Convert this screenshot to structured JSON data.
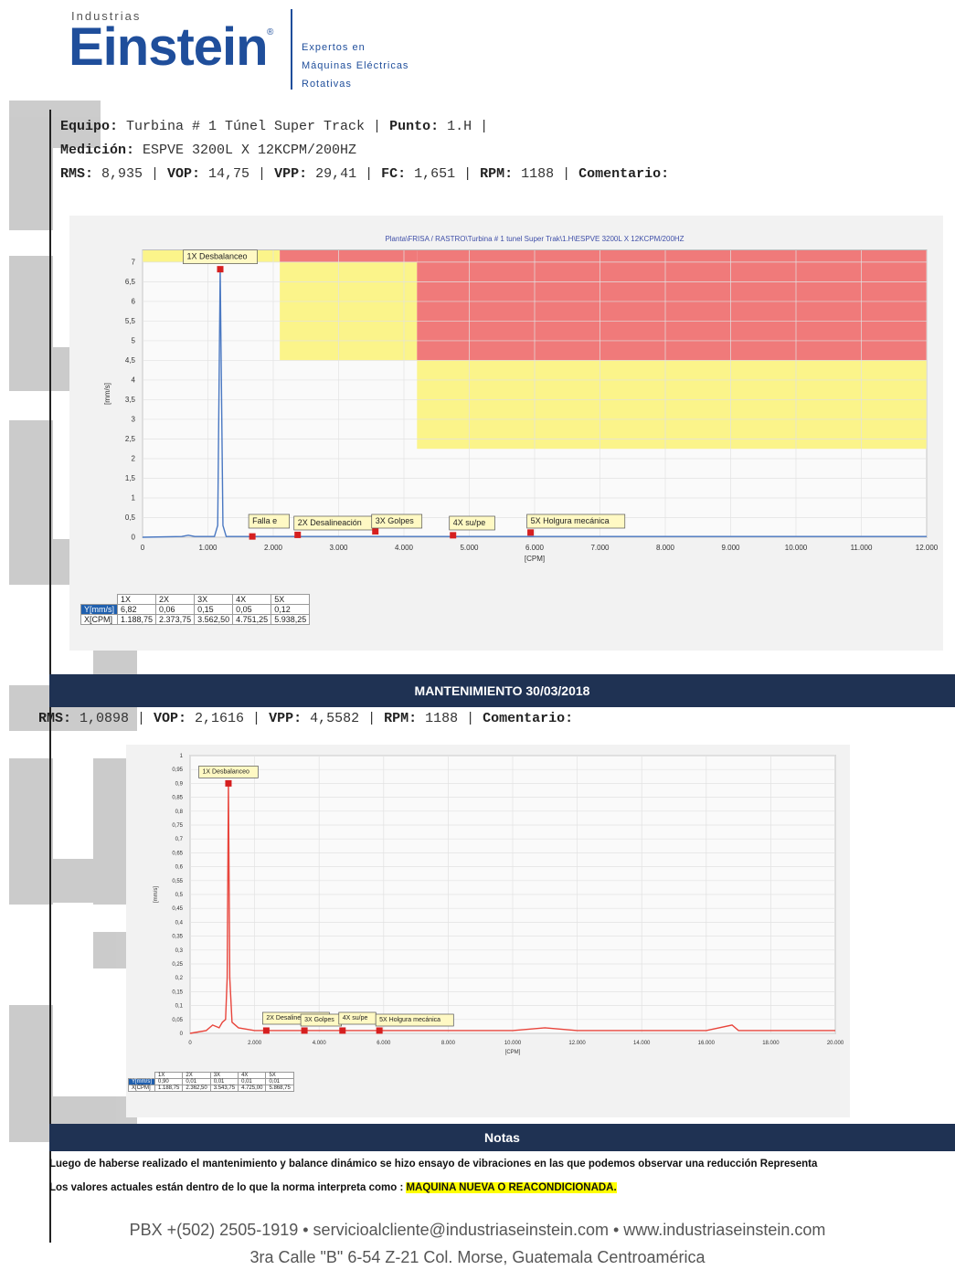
{
  "logo": {
    "small": "Industrias",
    "big": "Einstein",
    "reg": "®",
    "tag": [
      "Expertos en",
      "Máquinas Eléctricas",
      "Rotativas"
    ]
  },
  "header": {
    "line1": {
      "k1": "Equipo:",
      "v1": " Turbina # 1 Túnel Super Track | ",
      "k2": "Punto:",
      "v2": " 1.H |"
    },
    "line2": {
      "k1": "Medición:",
      "v1": " ESPVE 3200L X 12KCPM/200HZ"
    },
    "line3": {
      "k1": "RMS:",
      "v1": " 8,935 | ",
      "k2": "VOP:",
      "v2": " 14,75 | ",
      "k3": "VPP:",
      "v3": " 29,41 | ",
      "k4": "FC:",
      "v4": " 1,651 | ",
      "k5": "RPM:",
      "v5": " 1188 | ",
      "k6": "Comentario:"
    }
  },
  "chart1": {
    "title": "Planta\\FRISA / RASTRO\\Turbina # 1 tunel Super Trak\\1.H\\ESPVE 3200L X 12KCPM/200HZ",
    "table": {
      "headers": [
        "1X",
        "2X",
        "3X",
        "4X",
        "5X"
      ],
      "rows": [
        {
          "label": "Y[mm/s]",
          "values": [
            "6,82",
            "0,06",
            "0,15",
            "0,05",
            "0,12"
          ]
        },
        {
          "label": "X[CPM]",
          "values": [
            "1.188,75",
            "2.373,75",
            "3.562,50",
            "4.751,25",
            "5.938,25"
          ]
        }
      ]
    }
  },
  "chart_data": [
    {
      "type": "line",
      "title": "Planta\\FRISA / RASTRO\\Turbina # 1 tunel Super Trak\\1.H\\ESPVE 3200L X 12KCPM/200HZ",
      "xlabel": "[CPM]",
      "ylabel": "[mm/s]",
      "xlim": [
        0,
        12000
      ],
      "ylim": [
        0,
        7.3
      ],
      "x_ticks": [
        "0",
        "1.000",
        "2.000",
        "3.000",
        "4.000",
        "5.000",
        "6.000",
        "7.000",
        "8.000",
        "9.000",
        "10.000",
        "11.000",
        "12.000"
      ],
      "y_ticks": [
        "0",
        "0,5",
        "1",
        "1,5",
        "2",
        "2,5",
        "3",
        "3,5",
        "4",
        "4,5",
        "5",
        "5,5",
        "6",
        "6,5",
        "7"
      ],
      "series": [
        {
          "x": [
            0,
            600,
            700,
            800,
            1100,
            1150,
            1188,
            1230,
            1280,
            2000,
            4000,
            6000,
            8000,
            10000,
            12000
          ],
          "y": [
            0,
            0.02,
            0.05,
            0.02,
            0.02,
            0.3,
            6.82,
            0.3,
            0.02,
            0.02,
            0.02,
            0.02,
            0.02,
            0.02,
            0.02
          ]
        }
      ],
      "zones": [
        {
          "color": "#fbf48a",
          "x": [
            0,
            2100
          ],
          "y": [
            7.0,
            7.3
          ]
        },
        {
          "color": "#fbf48a",
          "x": [
            2100,
            4200
          ],
          "y": [
            4.5,
            7.0
          ]
        },
        {
          "color": "#f07a7a",
          "x": [
            2100,
            4200
          ],
          "y": [
            7.0,
            7.3
          ]
        },
        {
          "color": "#f07a7a",
          "x": [
            4200,
            12000
          ],
          "y": [
            4.5,
            7.3
          ]
        },
        {
          "color": "#fbf48a",
          "x": [
            4200,
            12000
          ],
          "y": [
            2.25,
            4.5
          ]
        }
      ],
      "markers": [
        {
          "label": "1X Desbalanceo",
          "x": 1188.75,
          "y": 6.82
        },
        {
          "label": "Falla e",
          "x": 1680,
          "y": 0.02
        },
        {
          "label": "2X Desalineación",
          "x": 2373.75,
          "y": 0.06
        },
        {
          "label": "3X Golpes",
          "x": 3562.5,
          "y": 0.15
        },
        {
          "label": "4X su/pe",
          "x": 4751.25,
          "y": 0.05
        },
        {
          "label": "5X Holgura mecánica",
          "x": 5938.25,
          "y": 0.12
        }
      ]
    },
    {
      "type": "line",
      "title": "",
      "xlabel": "[CPM]",
      "ylabel": "[mm/s]",
      "xlim": [
        0,
        20000
      ],
      "ylim": [
        0,
        1
      ],
      "x_ticks": [
        "0",
        "2.000",
        "4.000",
        "6.000",
        "8.000",
        "10.000",
        "12.000",
        "14.000",
        "16.000",
        "18.000",
        "20.000"
      ],
      "y_ticks": [
        "0",
        "0,05",
        "0,1",
        "0,15",
        "0,2",
        "0,25",
        "0,3",
        "0,35",
        "0,4",
        "0,45",
        "0,5",
        "0,55",
        "0,6",
        "0,65",
        "0,7",
        "0,75",
        "0,8",
        "0,85",
        "0,9",
        "0,95",
        "1"
      ],
      "series": [
        {
          "x": [
            0,
            500,
            700,
            900,
            1000,
            1100,
            1150,
            1188,
            1230,
            1300,
            1500,
            2000,
            3000,
            4000,
            5000,
            6000,
            7000,
            8000,
            9000,
            10000,
            11000,
            12000,
            13000,
            14000,
            15000,
            16000,
            16800,
            17000,
            18000,
            19000,
            20000
          ],
          "y": [
            0,
            0.01,
            0.03,
            0.02,
            0.04,
            0.05,
            0.2,
            0.9,
            0.2,
            0.04,
            0.02,
            0.01,
            0.01,
            0.01,
            0.01,
            0.01,
            0.01,
            0.01,
            0.01,
            0.01,
            0.02,
            0.01,
            0.01,
            0.01,
            0.01,
            0.01,
            0.03,
            0.01,
            0.01,
            0.01,
            0.01
          ]
        }
      ],
      "markers": [
        {
          "label": "1X Desbalanceo",
          "x": 1188.75,
          "y": 0.9
        },
        {
          "label": "2X Desalineación",
          "x": 2362.5,
          "y": 0.01
        },
        {
          "label": "3X Golpes",
          "x": 3543.75,
          "y": 0.01
        },
        {
          "label": "4X su/pe",
          "x": 4725,
          "y": 0.01
        },
        {
          "label": "5X Holgura mecánica",
          "x": 5868.75,
          "y": 0.01
        }
      ]
    }
  ],
  "banner1": "MANTENIMIENTO 30/03/2018",
  "line4": {
    "k1": "RMS:",
    "v1": " 1,0898 | ",
    "k2": "VOP:",
    "v2": " 2,1616 | ",
    "k3": "VPP:",
    "v3": " 4,5582 | ",
    "k4": "RPM:",
    "v4": " 1188 | ",
    "k5": "Comentario:"
  },
  "chart2": {
    "table": {
      "headers": [
        "1X",
        "2X",
        "3X",
        "4X",
        "5X"
      ],
      "rows": [
        {
          "label": "Y[mm/s]",
          "values": [
            "0,90",
            "0,01",
            "0,01",
            "0,01",
            "0,01"
          ]
        },
        {
          "label": "X[CPM]",
          "values": [
            "1.188,75",
            "2.362,50",
            "3.543,75",
            "4.725,00",
            "5.868,75"
          ]
        }
      ]
    }
  },
  "banner2": "Notas",
  "notes": {
    "line1": "Luego de haberse realizado el mantenimiento y balance dinámico se hizo ensayo de vibraciones en las que podemos observar una reducción Representa",
    "line2_pre": "Los valores actuales están dentro de lo que la norma interpreta como : ",
    "line2_hl": "MAQUINA NUEVA O REACONDICIONADA."
  },
  "footer": {
    "line1": "PBX +(502) 2505-1919  •  servicioalcliente@industriaseinstein.com  •  www.industriaseinstein.com",
    "line2": "3ra Calle \"B\" 6-54 Z-21 Col. Morse, Guatemala Centroamérica"
  },
  "colors": {
    "brand": "#1f4e9b",
    "banner": "#1f3253",
    "alarm_red": "#f07a7a",
    "alarm_yellow": "#fbf48a",
    "trace1": "#4a78c2",
    "trace2": "#e8453c",
    "watermark": "#c7c7c7"
  }
}
